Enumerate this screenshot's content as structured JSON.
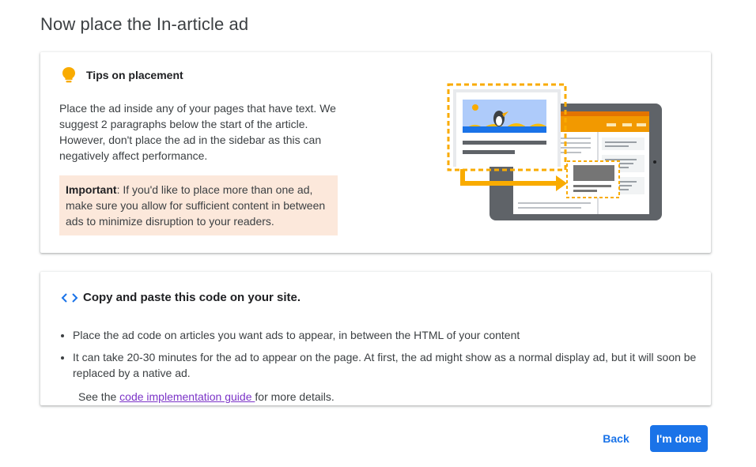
{
  "page": {
    "title": "Now place the In-article ad"
  },
  "tips": {
    "icon": "lightbulb-icon",
    "title": "Tips on placement",
    "body": "Place the ad inside any of your pages that have text. We suggest 2 paragraphs below the start of the article. However, don't place the ad in the sidebar as this can negatively affect performance.",
    "important_label": "Important",
    "important_text": ": If you'd like to place more than one ad, make sure you allow for sufficient content in between ads to minimize disruption to your readers."
  },
  "code": {
    "icon": "code-brackets-icon",
    "title": "Copy and paste this code on your site.",
    "bullets": [
      "Place the ad code on articles you want ads to appear, in between the HTML of your content",
      "It can take 20-30 minutes for the ad to appear on the page. At first, the ad might show as a normal display ad, but it will soon be replaced by a native ad."
    ],
    "see_prefix": "See the ",
    "link_text": "code implementation guide ",
    "see_suffix": "for more details."
  },
  "actions": {
    "back_label": "Back",
    "done_label": "I'm done"
  },
  "colors": {
    "accent": "#1a73e8",
    "warning_bg": "#fce8db",
    "bulb": "#f9ab00",
    "orange": "#f29900",
    "link_visited": "#7b33c7"
  }
}
